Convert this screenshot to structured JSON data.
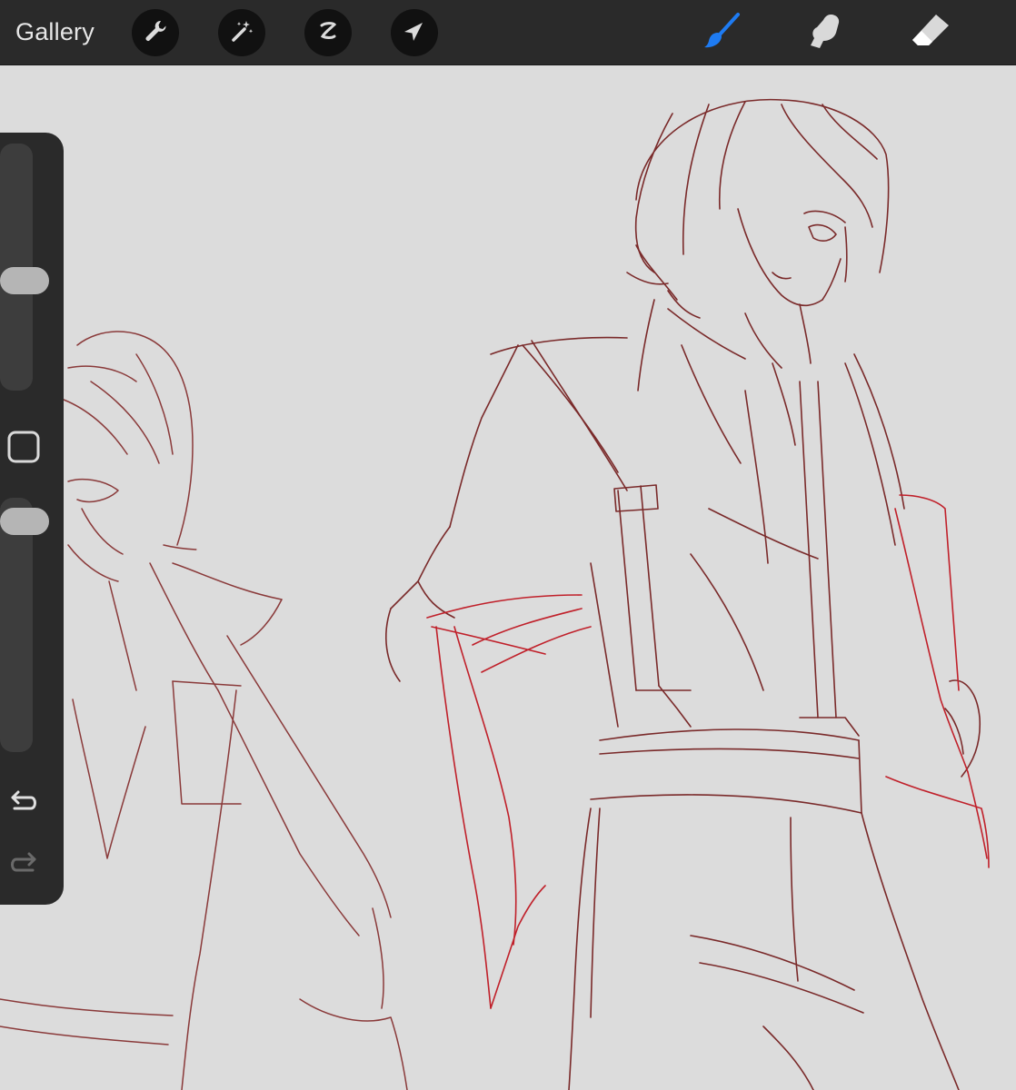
{
  "toolbar": {
    "gallery_label": "Gallery",
    "left_tools": [
      {
        "name": "actions",
        "icon": "wrench-icon"
      },
      {
        "name": "adjustments",
        "icon": "magic-wand-icon"
      },
      {
        "name": "selection",
        "icon": "selection-s-icon"
      },
      {
        "name": "transform",
        "icon": "arrow-cursor-icon"
      }
    ],
    "right_tools": [
      {
        "name": "brush",
        "icon": "brush-icon",
        "active": true
      },
      {
        "name": "smudge",
        "icon": "smudge-finger-icon",
        "active": false
      },
      {
        "name": "eraser",
        "icon": "eraser-icon",
        "active": false
      }
    ]
  },
  "sidebar": {
    "brush_size_level": 0.55,
    "opacity_level": 0.95,
    "modify_icon": "square-icon",
    "undo_icon": "undo-icon",
    "redo_icon": "redo-icon"
  },
  "colors": {
    "toolbar_bg": "#2a2a2a",
    "canvas_bg": "#dcdcdc",
    "active_tool": "#1e7bf2",
    "icon_inactive": "#d9d9d9",
    "sketch_dark_red": "#7a2a2a",
    "sketch_bright_red": "#c0202a"
  }
}
